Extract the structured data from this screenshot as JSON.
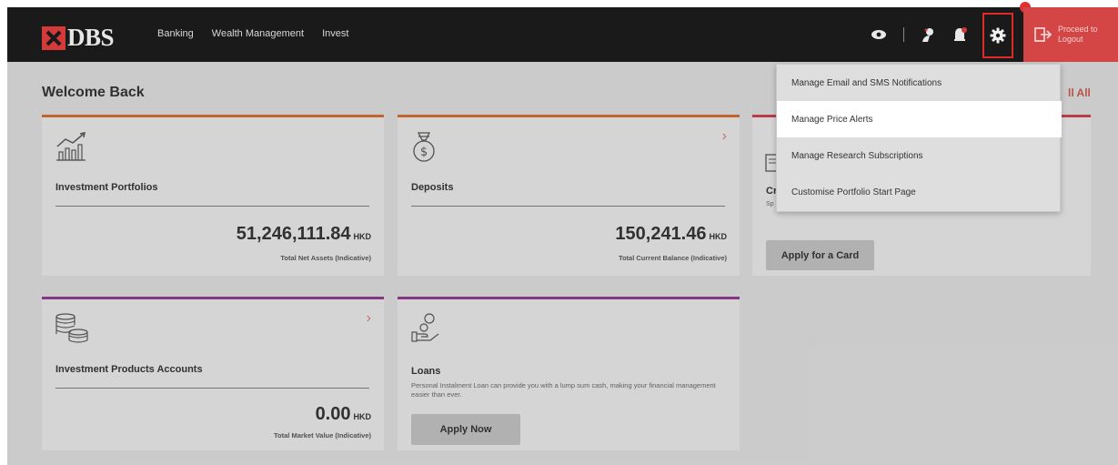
{
  "header": {
    "logo_text": "DBS",
    "nav": [
      "Banking",
      "Wealth Management",
      "Invest"
    ],
    "logout_label_line1": "Proceed to",
    "logout_label_line2": "Logout"
  },
  "main": {
    "welcome": "Welcome Back",
    "see_all_fragment": "ll All"
  },
  "cards": {
    "investment_portfolios": {
      "title": "Investment Portfolios",
      "amount": "51,246,111.84",
      "currency": "HKD",
      "caption": "Total Net Assets (Indicative)"
    },
    "deposits": {
      "title": "Deposits",
      "amount": "150,241.46",
      "currency": "HKD",
      "caption": "Total Current Balance (Indicative)"
    },
    "credit_cards": {
      "title_fragment": "Cr",
      "sub_fragment": "Sp",
      "button": "Apply for a Card"
    },
    "investment_products": {
      "title": "Investment Products Accounts",
      "amount": "0.00",
      "currency": "HKD",
      "caption": "Total Market Value (Indicative)"
    },
    "loans": {
      "title": "Loans",
      "desc": "Personal Instalment Loan can provide you with a lump sum cash, making your financial management easier than ever.",
      "button": "Apply Now"
    }
  },
  "settings_menu": {
    "items": [
      "Manage Email and SMS Notifications",
      "Manage Price Alerts",
      "Manage Research Subscriptions",
      "Customise Portfolio Start Page"
    ],
    "highlighted_index": 1
  },
  "colors": {
    "header_bg": "#1a1a1a",
    "brand_red": "#d43a3a",
    "highlight_border": "#e02a2a",
    "card_accent_orange": "#c96a2d",
    "card_accent_purple": "#8a3a8a",
    "card_accent_red": "#c0404a"
  },
  "icons": [
    "eye-icon",
    "user-support-icon",
    "notification-bell-icon",
    "gear-icon",
    "logout-icon",
    "chart-icon",
    "money-bag-icon",
    "credit-card-icon",
    "coins-stack-icon",
    "hand-coin-icon",
    "chevron-right-icon"
  ]
}
